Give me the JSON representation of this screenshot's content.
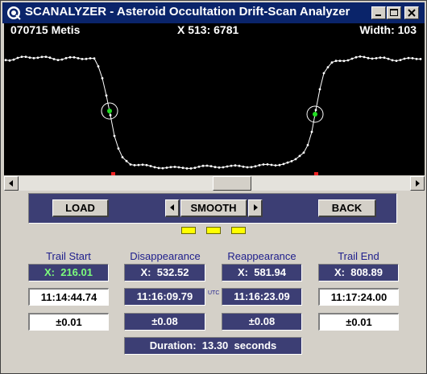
{
  "window": {
    "title": "SCANALYZER - Asteroid Occultation Drift-Scan Analyzer"
  },
  "scope": {
    "object_label": "070715 Metis",
    "cursor_readout": "X 513: 6781",
    "width_readout": "Width: 103"
  },
  "controls": {
    "load_label": "LOAD",
    "smooth_label": "SMOOTH",
    "back_label": "BACK"
  },
  "columns": {
    "trail_start": {
      "heading": "Trail Start",
      "x": "X:  216.01",
      "time": "11:14:44.74",
      "err": "±0.01"
    },
    "disappearance": {
      "heading": "Disappearance",
      "x": "X:  532.52",
      "time": "11:16:09.79",
      "err": "±0.08"
    },
    "reappearance": {
      "heading": "Reappearance",
      "x": "X:  581.94",
      "time": "11:16:23.09",
      "err": "±0.08"
    },
    "trail_end": {
      "heading": "Trail End",
      "x": "X:  808.89",
      "time": "11:17:24.00",
      "err": "±0.01"
    }
  },
  "utc_label": "UTC",
  "duration": "Duration:  13.30  seconds",
  "colors": {
    "scope_bg": "#000000",
    "trace": "#ffffff",
    "marker": "#22dd22",
    "panel": "#3c3e74",
    "titlebar": "#0a246a",
    "led": "#ffff00"
  }
}
